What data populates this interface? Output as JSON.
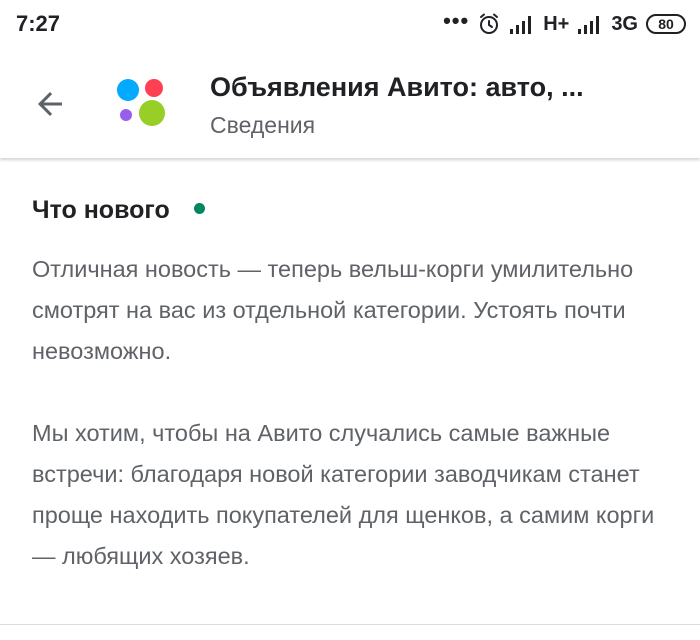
{
  "status_bar": {
    "time": "7:27",
    "dots": "•••",
    "network_1": "H+",
    "network_2": "3G",
    "battery": "80",
    "icons": [
      "alarm-icon",
      "signal-icon"
    ]
  },
  "app_bar": {
    "title": "Объявления Авито: авто, ...",
    "subtitle": "Сведения",
    "icons": [
      "back-arrow-icon",
      "avito-app-icon"
    ],
    "app_icon_colors": {
      "blue": "#00AAFF",
      "red": "#FF4053",
      "purple": "#965EEB",
      "green": "#97CF26"
    }
  },
  "whats_new": {
    "title": "Что нового",
    "indicator_color": "#01875f",
    "paragraphs": [
      "Отличная новость — теперь вельш-корги умилительно смотрят на вас из отдельной категории. Устоять почти невозможно.",
      "Мы хотим, чтобы на Авито случались самые важные встречи: благодаря новой категории заводчикам станет проще находить покупателей для щенков, а самим корги — любящих хозяев."
    ]
  }
}
